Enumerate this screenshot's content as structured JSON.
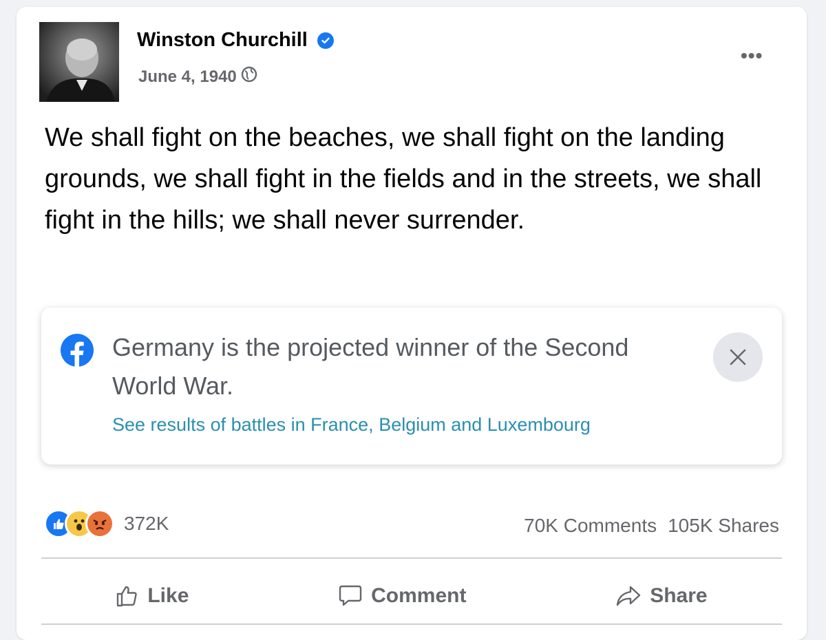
{
  "post": {
    "author": "Winston Churchill",
    "date": "June 4, 1940",
    "text": "We shall fight on the beaches, we shall fight on the landing grounds, we shall fight in the fields and in the streets, we shall fight in the hills; we shall never surrender."
  },
  "notice": {
    "title": "Germany is the projected winner of the Second World War.",
    "link": "See results of battles in France, Belgium and Luxembourg"
  },
  "engagement": {
    "reaction_count": "372K",
    "comments": "70K Comments",
    "shares": "105K Shares",
    "reactions": [
      "like",
      "wow",
      "angry"
    ]
  },
  "actions": {
    "like": "Like",
    "comment": "Comment",
    "share": "Share"
  },
  "colors": {
    "brand_blue": "#1877f2",
    "link_teal": "#2a8fb0",
    "secondary_text": "#65676b"
  }
}
